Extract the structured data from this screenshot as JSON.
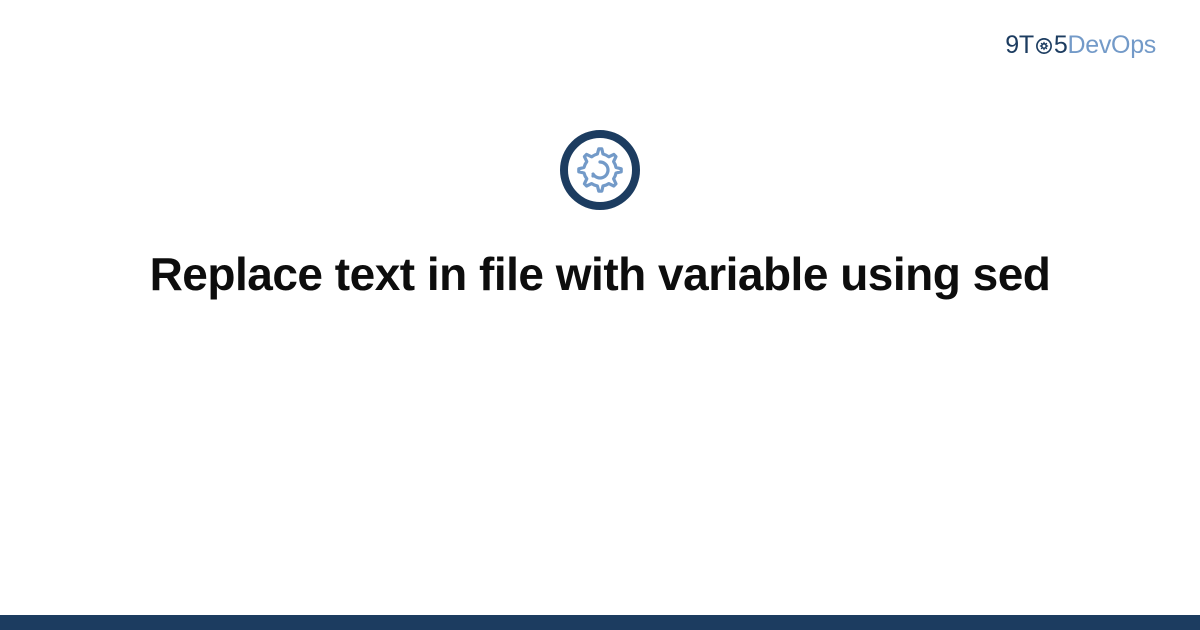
{
  "brand": {
    "nine": "9",
    "t": "T",
    "five": "5",
    "dev": "Dev",
    "ops": "Ops"
  },
  "main": {
    "title": "Replace text in file with variable using sed"
  },
  "colors": {
    "primary_dark": "#1c3c60",
    "primary_light": "#739ac8",
    "text": "#0d0d0d"
  }
}
